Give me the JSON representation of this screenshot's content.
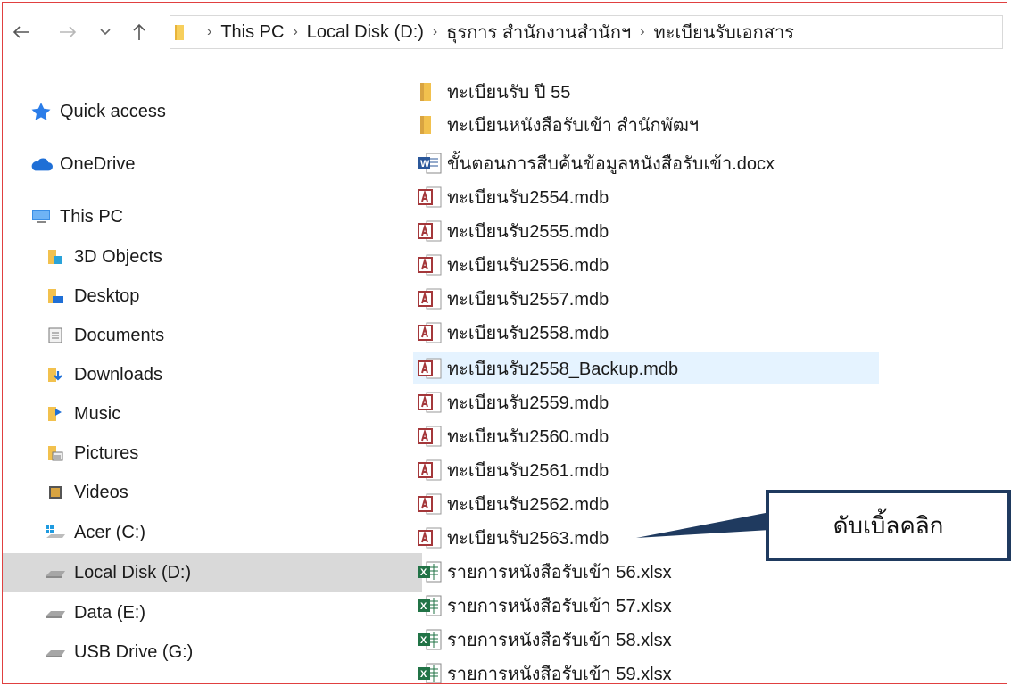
{
  "breadcrumb": [
    "This PC",
    "Local Disk (D:)",
    "ธุรการ สำนักงานสำนักฯ",
    "ทะเบียนรับเอกสาร"
  ],
  "sidebar": {
    "items": [
      {
        "label": "Quick access",
        "icon": "star-icon"
      },
      {
        "label": "OneDrive",
        "icon": "cloud-icon"
      },
      {
        "label": "This PC",
        "icon": "computer-icon"
      },
      {
        "label": "3D Objects",
        "icon": "3d-objects-icon"
      },
      {
        "label": "Desktop",
        "icon": "desktop-folder-icon"
      },
      {
        "label": "Documents",
        "icon": "documents-folder-icon"
      },
      {
        "label": "Downloads",
        "icon": "downloads-folder-icon"
      },
      {
        "label": "Music",
        "icon": "music-folder-icon"
      },
      {
        "label": "Pictures",
        "icon": "pictures-folder-icon"
      },
      {
        "label": "Videos",
        "icon": "videos-folder-icon"
      },
      {
        "label": "Acer (C:)",
        "icon": "windows-drive-icon"
      },
      {
        "label": "Local Disk (D:)",
        "icon": "drive-icon",
        "selected": true
      },
      {
        "label": "Data (E:)",
        "icon": "drive-icon"
      },
      {
        "label": "USB Drive (G:)",
        "icon": "drive-icon"
      }
    ]
  },
  "files": [
    {
      "name": "ทะเบียนรับ ปี 55",
      "type": "folder"
    },
    {
      "name": "ทะเบียนหนังสือรับเข้า สำนักพัฒฯ",
      "type": "folder"
    },
    {
      "name": "ขั้นตอนการสืบค้นข้อมูลหนังสือรับเข้า.docx",
      "type": "word"
    },
    {
      "name": "ทะเบียนรับ2554.mdb",
      "type": "access"
    },
    {
      "name": "ทะเบียนรับ2555.mdb",
      "type": "access"
    },
    {
      "name": "ทะเบียนรับ2556.mdb",
      "type": "access"
    },
    {
      "name": "ทะเบียนรับ2557.mdb",
      "type": "access"
    },
    {
      "name": "ทะเบียนรับ2558.mdb",
      "type": "access"
    },
    {
      "name": "ทะเบียนรับ2558_Backup.mdb",
      "type": "access",
      "hover": true
    },
    {
      "name": "ทะเบียนรับ2559.mdb",
      "type": "access"
    },
    {
      "name": "ทะเบียนรับ2560.mdb",
      "type": "access"
    },
    {
      "name": "ทะเบียนรับ2561.mdb",
      "type": "access"
    },
    {
      "name": "ทะเบียนรับ2562.mdb",
      "type": "access"
    },
    {
      "name": "ทะเบียนรับ2563.mdb",
      "type": "access"
    },
    {
      "name": "รายการหนังสือรับเข้า 56.xlsx",
      "type": "excel"
    },
    {
      "name": "รายการหนังสือรับเข้า 57.xlsx",
      "type": "excel"
    },
    {
      "name": "รายการหนังสือรับเข้า 58.xlsx",
      "type": "excel"
    },
    {
      "name": "รายการหนังสือรับเข้า 59.xlsx",
      "type": "excel"
    }
  ],
  "callout": {
    "text": "ดับเบิ้ลคลิก"
  },
  "colors": {
    "selected_bg": "#d9d9d9",
    "hover_bg": "#e5f3ff",
    "frame_border": "#e04040",
    "callout_border": "#1f3a5f"
  }
}
